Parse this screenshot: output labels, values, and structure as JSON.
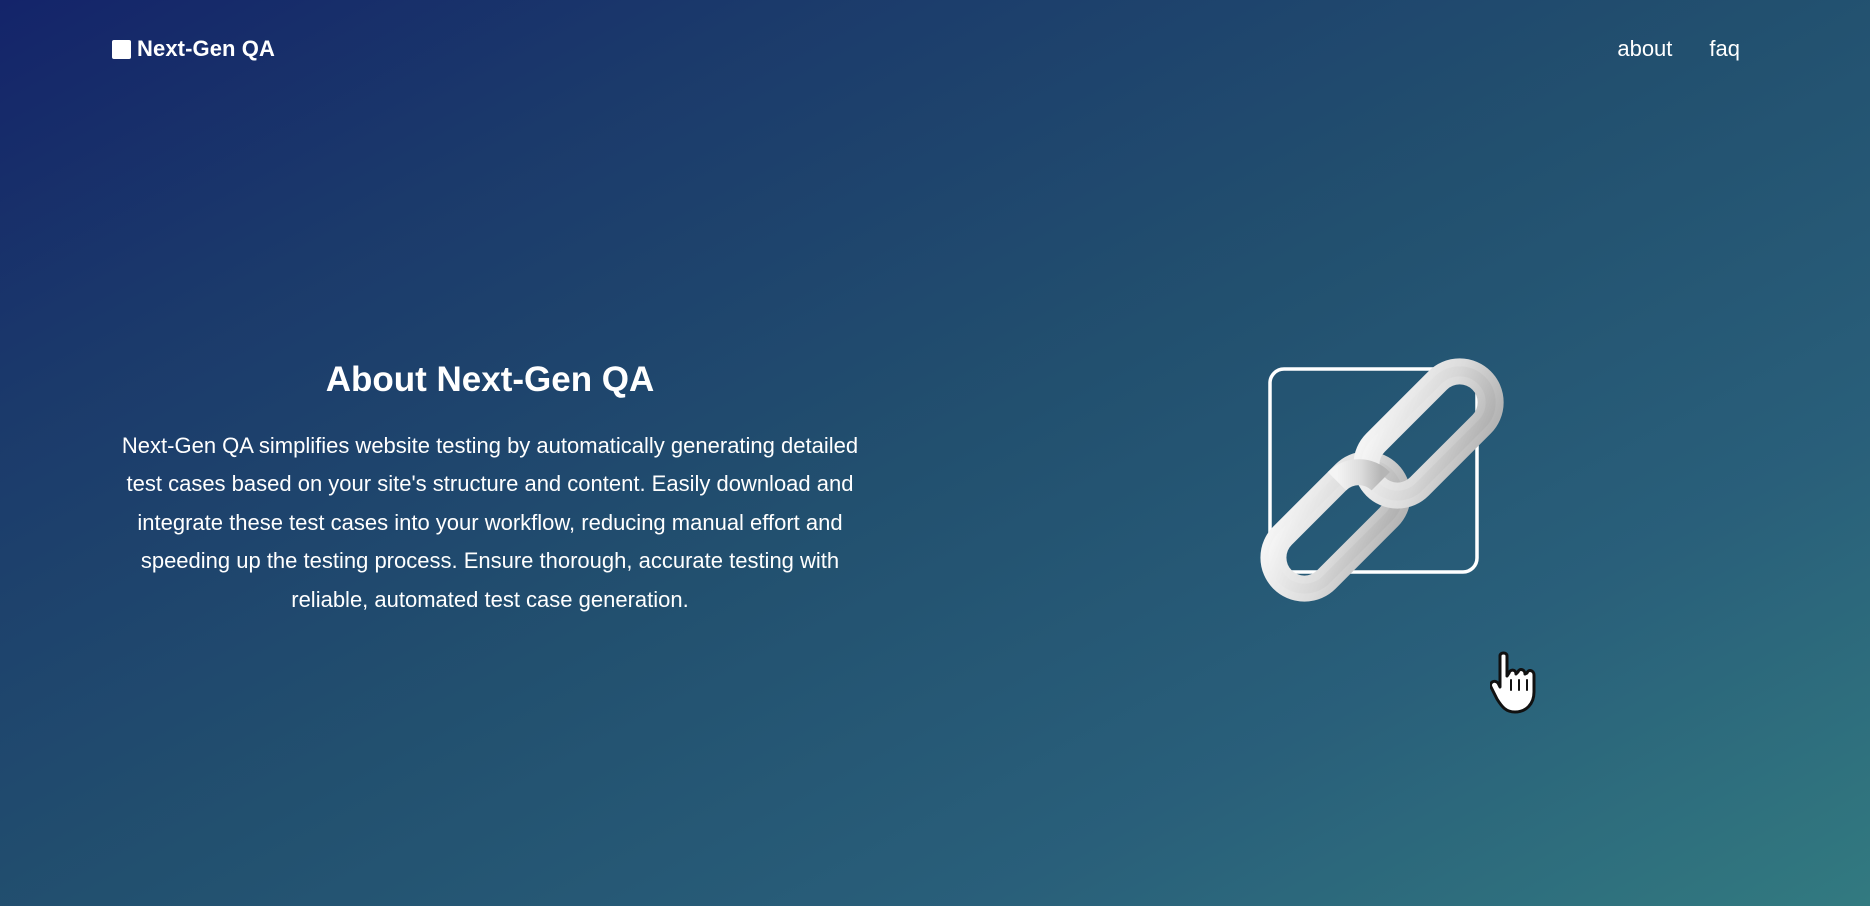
{
  "nav": {
    "brand_icon": "square-logo-icon",
    "brand_name": "Next-Gen QA",
    "links": [
      {
        "label": "about"
      },
      {
        "label": "faq"
      }
    ]
  },
  "hero": {
    "title": "About Next-Gen QA",
    "description": "Next-Gen QA simplifies website testing by automatically generating detailed test cases based on your site's structure and content. Easily download and integrate these test cases into your workflow, reducing manual effort and speeding up the testing process. Ensure thorough, accurate testing with reliable, automated test case generation."
  },
  "illustration": {
    "icon": "chain-link-icon",
    "cursor_icon": "hand-pointer-icon"
  },
  "colors": {
    "gradient_start": "#14246a",
    "gradient_end": "#327a80",
    "text": "#ffffff",
    "link_chain": "#e6e6e6"
  }
}
